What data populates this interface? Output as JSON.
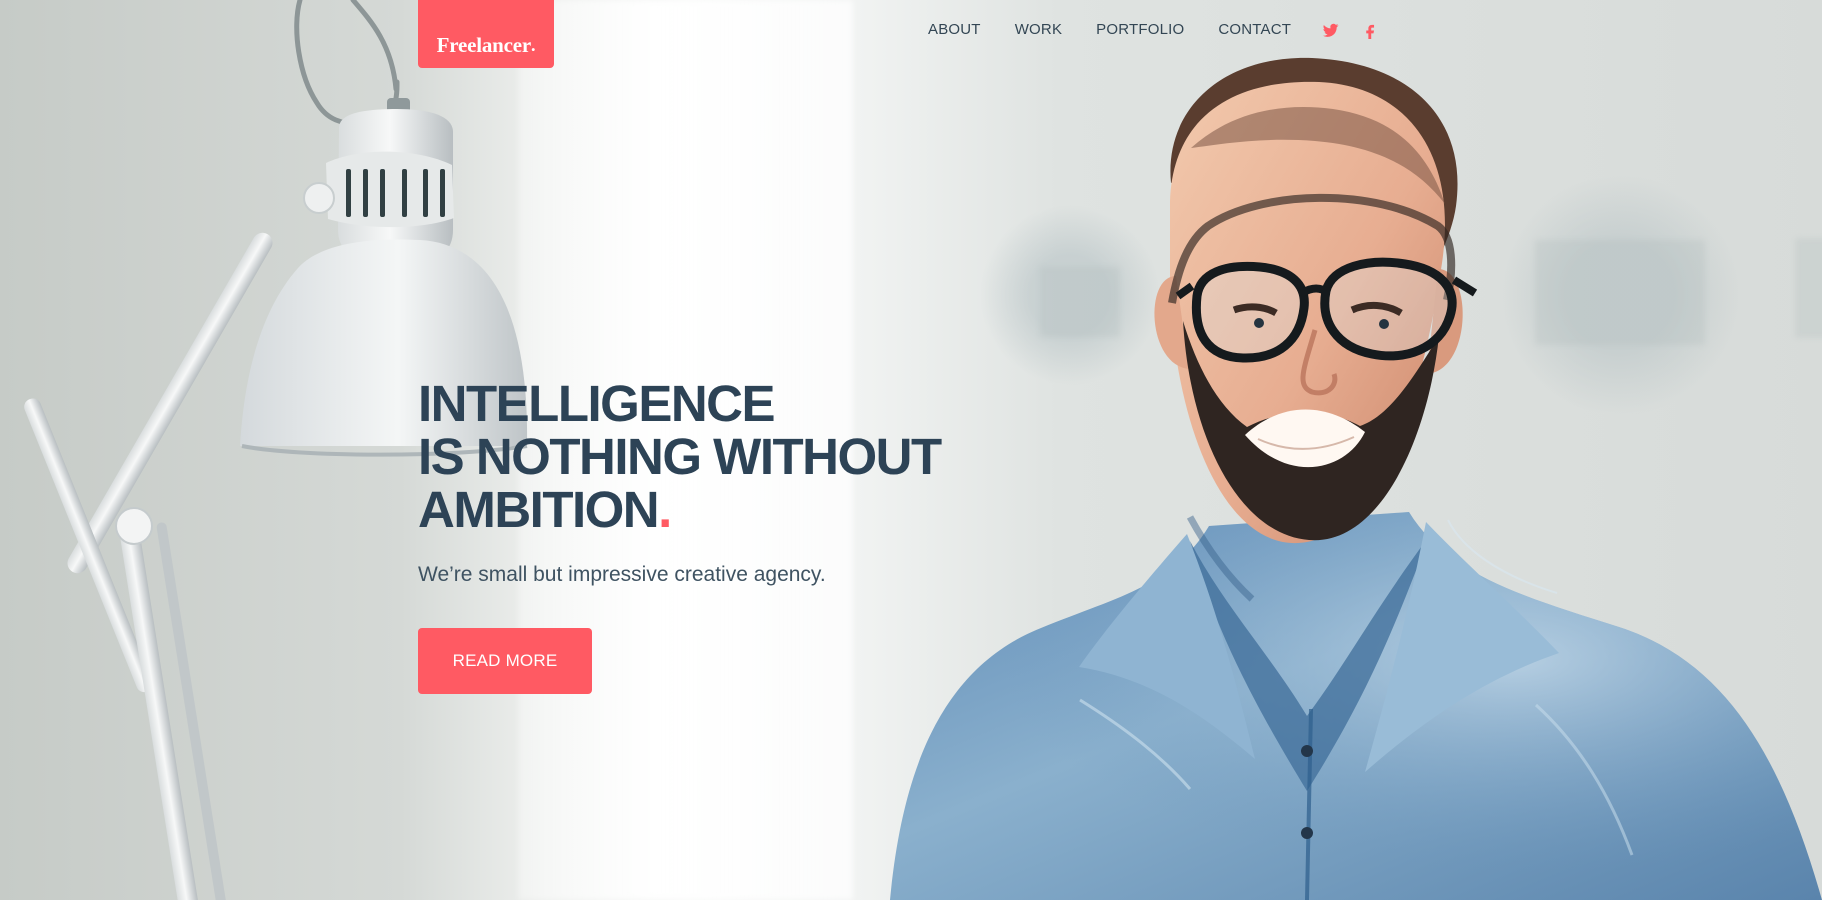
{
  "brand": {
    "name": "Freelancer",
    "dot": ".",
    "accent_color": "#ff5a63"
  },
  "navigation": {
    "items": [
      {
        "label": "ABOUT"
      },
      {
        "label": "WORK"
      },
      {
        "label": "PORTFOLIO"
      },
      {
        "label": "CONTACT"
      }
    ],
    "social_icons": [
      "twitter-icon",
      "facebook-icon"
    ]
  },
  "hero": {
    "headline_lines": [
      "INTELLIGENCE",
      "IS NOTHING WITHOUT",
      "AMBITION"
    ],
    "headline_dot": ".",
    "subtitle": "We’re small but impressive creative agency.",
    "button_label": "READ MORE",
    "text_color": "#2d4356",
    "button_color": "#ff5a63"
  }
}
